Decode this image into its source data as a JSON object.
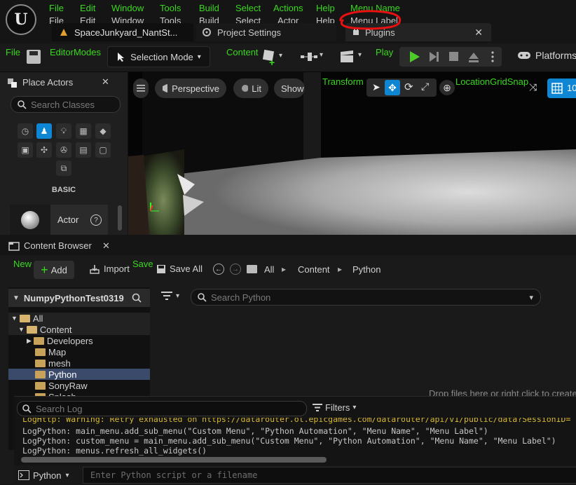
{
  "menu": {
    "overlay_row": [
      "File",
      "Edit",
      "Window",
      "Tools",
      "Build",
      "Select",
      "Actions",
      "Help",
      "Menu Name"
    ],
    "real_row": [
      "File",
      "Edit",
      "Window",
      "Tools",
      "Build",
      "Select",
      "Actor",
      "Help",
      "Menu Label"
    ]
  },
  "tabs": [
    {
      "label": "SpaceJunkyard_NantSt..."
    },
    {
      "label": "Project Settings"
    },
    {
      "label": "Plugins"
    }
  ],
  "toolbar": {
    "file_tag": "File",
    "editormodes_tag": "EditorModes",
    "selection_mode": "Selection Mode",
    "content_tag": "Content",
    "play_tag": "Play",
    "platforms": "Platforms"
  },
  "place_actors": {
    "title": "Place Actors",
    "search_placeholder": "Search Classes",
    "category": "BASIC",
    "actor_label": "Actor"
  },
  "viewport": {
    "perspective": "Perspective",
    "lit": "Lit",
    "show": "Show",
    "transform_tag": "Transform",
    "location_tag": "LocationGridSnap",
    "grid_value": "10"
  },
  "content_browser": {
    "title": "Content Browser",
    "new_tag": "New",
    "save_tag": "Save",
    "add": "Add",
    "import": "Import",
    "save_all": "Save All",
    "breadcrumb": [
      "All",
      "Content",
      "Python"
    ],
    "project": "NumpyPythonTest0319",
    "search_placeholder": "Search Python",
    "drop_hint": "Drop files here or right click to create",
    "tree": [
      {
        "label": "All",
        "indent": 0,
        "open": true
      },
      {
        "label": "Content",
        "indent": 1,
        "open": true
      },
      {
        "label": "Developers",
        "indent": 2,
        "open": false
      },
      {
        "label": "Map",
        "indent": 2,
        "open": false
      },
      {
        "label": "mesh",
        "indent": 2,
        "open": false
      },
      {
        "label": "Python",
        "indent": 2,
        "open": false,
        "selected": true
      },
      {
        "label": "SonyRaw",
        "indent": 2,
        "open": false
      },
      {
        "label": "Splash",
        "indent": 2,
        "open": false
      }
    ]
  },
  "output_log": {
    "search_placeholder": "Search Log",
    "filters": "Filters",
    "lines": [
      "LogHttp: Warning: Retry exhausted on https://datarouter.ol.epicgames.com/datarouter/api/v1/public/data?SessionID=",
      "LogPython: main_menu.add_sub_menu(\"Custom Menu\", \"Python Automation\", \"Menu Name\", \"Menu Label\")",
      "LogPython: custom_menu = main_menu.add_sub_menu(\"Custom Menu\", \"Python Automation\", \"Menu Name\", \"Menu Label\")",
      "LogPython: menus.refresh_all_widgets()"
    ],
    "console_mode": "Python",
    "console_placeholder": "Enter Python script or a filename"
  },
  "colors": {
    "annotation_green": "#39d81e",
    "highlight_red": "#e81010",
    "accent_blue": "#0e86d4"
  }
}
